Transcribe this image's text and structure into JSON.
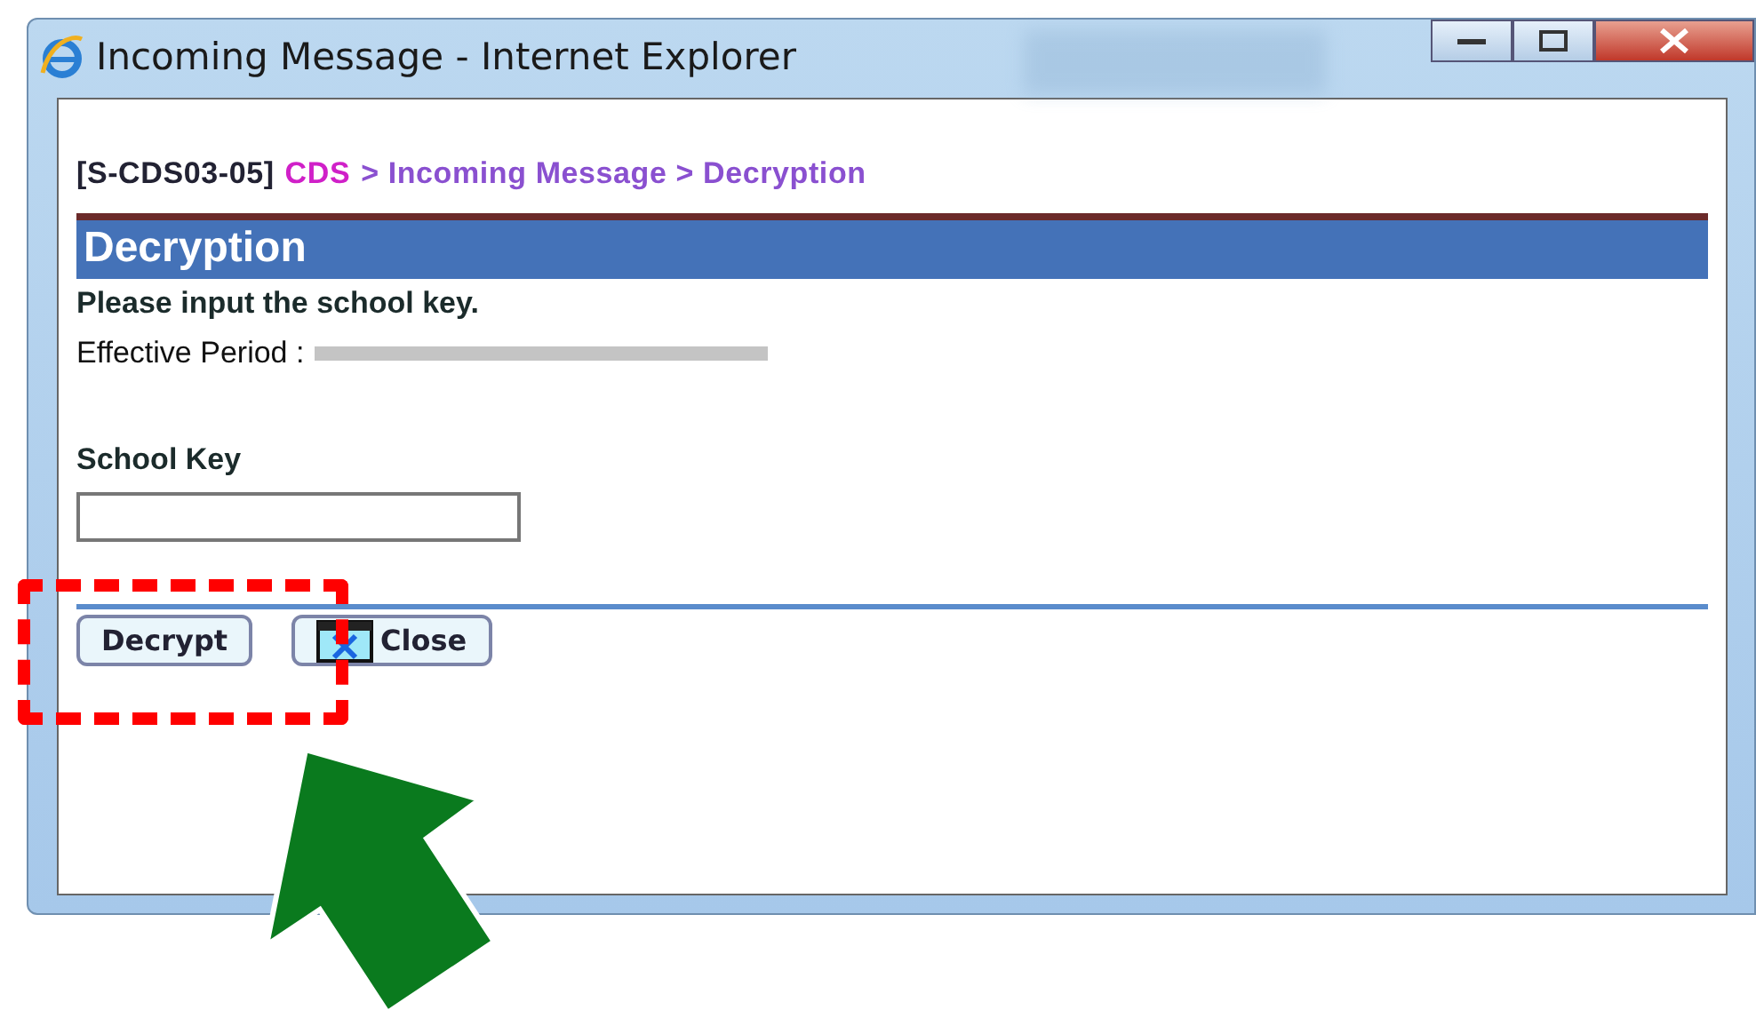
{
  "window": {
    "title": "Incoming Message - Internet Explorer"
  },
  "breadcrumb": {
    "code": "[S-CDS03-05]",
    "module": "CDS",
    "path": "> Incoming Message > Decryption"
  },
  "section": {
    "title": "Decryption"
  },
  "instruction": "Please input the school key.",
  "effective_period": {
    "label": "Effective Period :"
  },
  "school_key": {
    "label": "School Key"
  },
  "buttons": [
    {
      "label": "Decrypt",
      "kind": "plain"
    },
    {
      "label": "Close",
      "kind": "close"
    }
  ]
}
